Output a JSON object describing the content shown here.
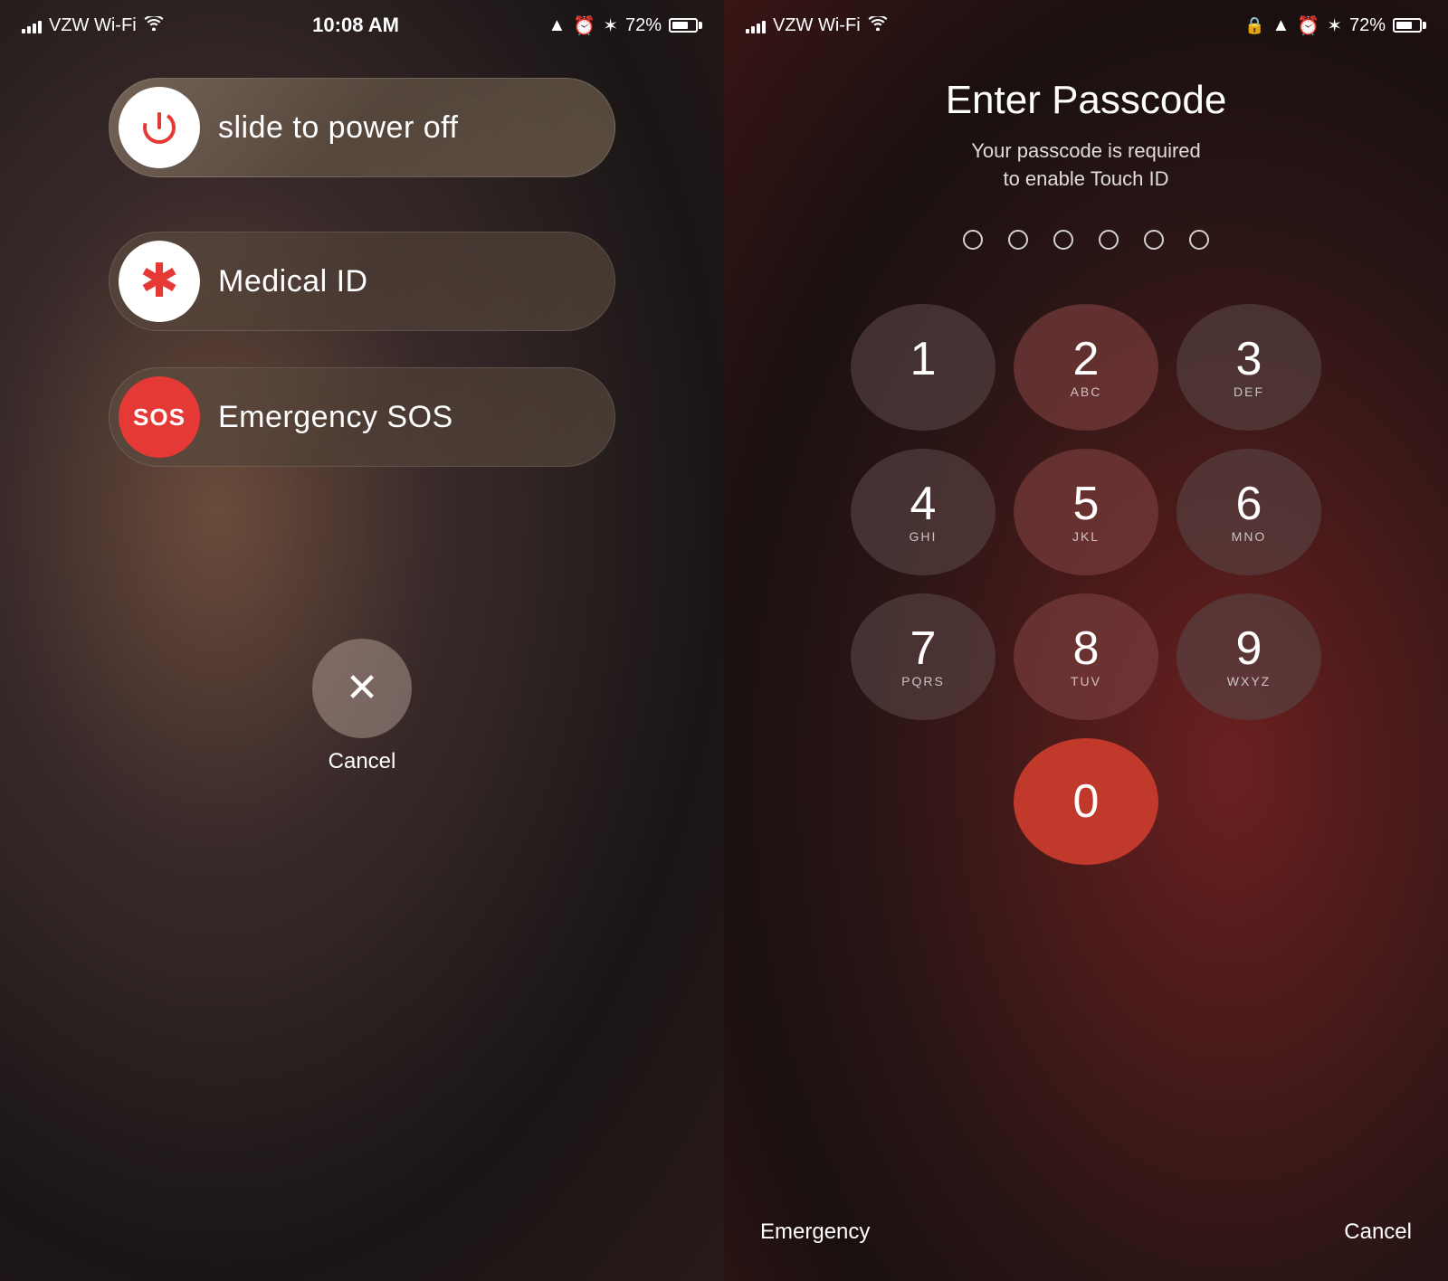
{
  "left": {
    "statusBar": {
      "carrier": "VZW Wi-Fi",
      "time": "10:08 AM",
      "battery": "72%"
    },
    "powerOff": {
      "label": "slide to power off"
    },
    "medicalId": {
      "label": "Medical ID"
    },
    "emergencySos": {
      "label": "Emergency SOS",
      "badge": "SOS"
    },
    "cancel": {
      "label": "Cancel"
    }
  },
  "right": {
    "statusBar": {
      "carrier": "VZW Wi-Fi",
      "time": "",
      "battery": "72%"
    },
    "title": "Enter Passcode",
    "subtitle": "Your passcode is required\nto enable Touch ID",
    "numpad": [
      {
        "digit": "1",
        "letters": ""
      },
      {
        "digit": "2",
        "letters": "ABC"
      },
      {
        "digit": "3",
        "letters": "DEF"
      },
      {
        "digit": "4",
        "letters": "GHI"
      },
      {
        "digit": "5",
        "letters": "JKL"
      },
      {
        "digit": "6",
        "letters": "MNO"
      },
      {
        "digit": "7",
        "letters": "PQRS"
      },
      {
        "digit": "8",
        "letters": "TUV"
      },
      {
        "digit": "9",
        "letters": "WXYZ"
      },
      {
        "digit": "0",
        "letters": ""
      }
    ],
    "bottomLeft": "Emergency",
    "bottomRight": "Cancel"
  }
}
